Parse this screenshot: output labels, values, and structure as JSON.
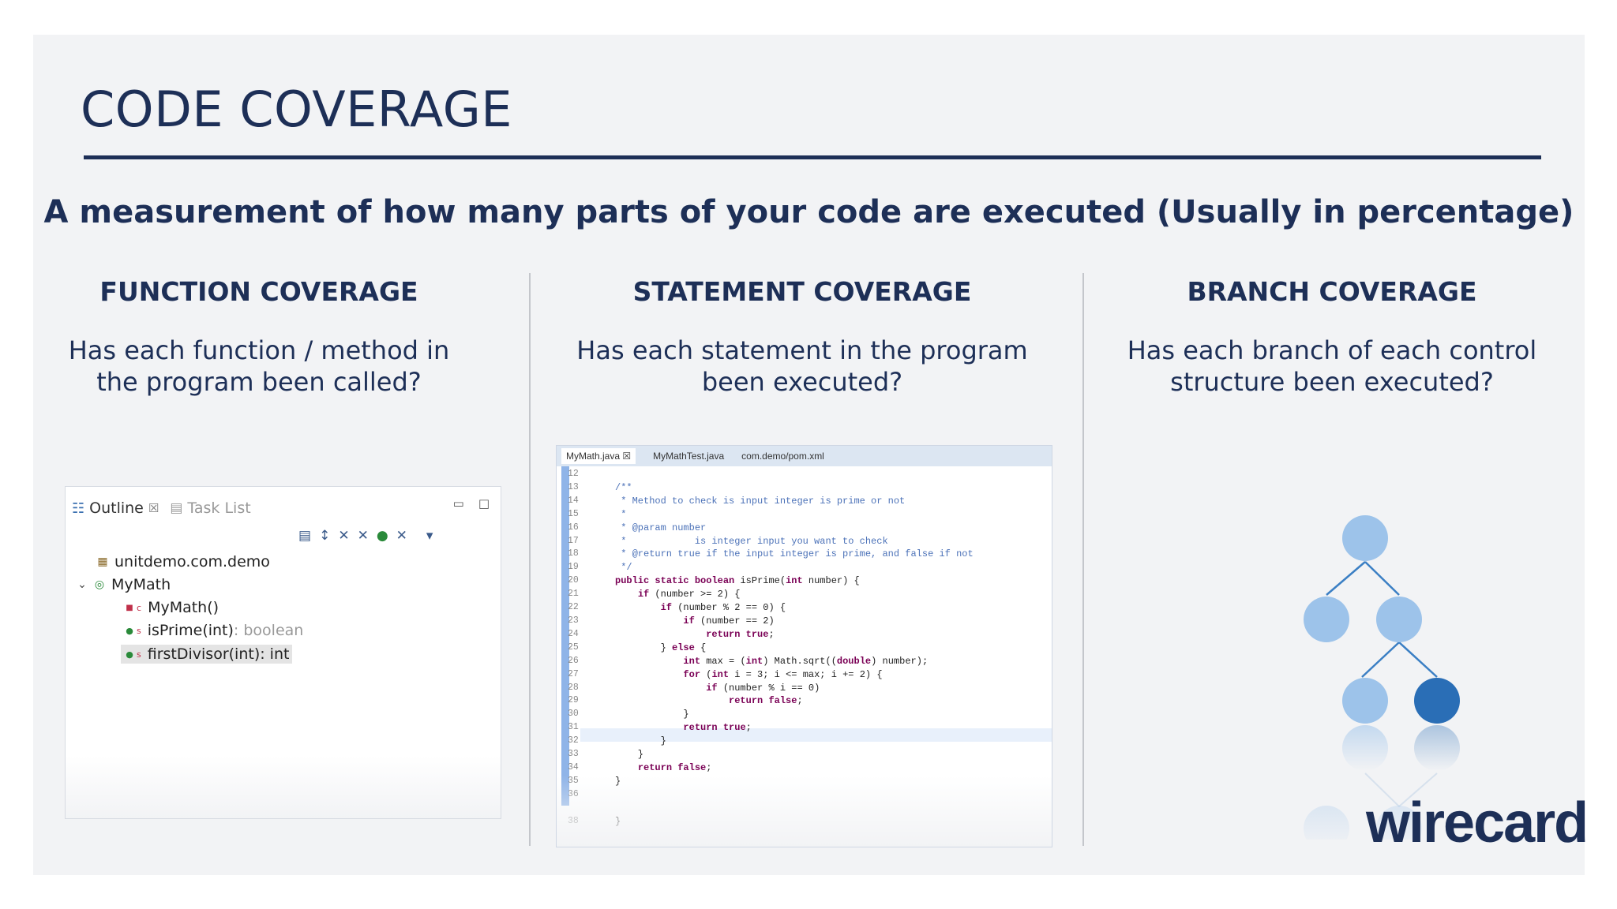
{
  "slide": {
    "title": "CODE COVERAGE",
    "subtitle": "A measurement of how many parts of your code are executed (Usually in percentage)",
    "logo": "wirecard",
    "colors": {
      "navy": "#1d2f57",
      "node_light": "#9dc3ea",
      "node_dark": "#2a6eb6",
      "background": "#f2f3f5"
    }
  },
  "columns": [
    {
      "heading": "FUNCTION COVERAGE",
      "desc_line1": "Has each function / method in",
      "desc_line2": "the program been called?"
    },
    {
      "heading": "STATEMENT COVERAGE",
      "desc_line1": "Has each statement in the program",
      "desc_line2": "been executed?"
    },
    {
      "heading": "BRANCH COVERAGE",
      "desc_line1": "Has each branch of each control",
      "desc_line2": "structure been executed?"
    }
  ],
  "outline_panel": {
    "tab_outline": "Outline",
    "tab_outline_close": "☒",
    "tab_tasklist": "Task List",
    "win_minimize": "▭",
    "win_maximize": "□",
    "toolbar_icons": [
      "▤",
      "↕",
      "✕",
      "✕",
      "●",
      "✕",
      "▾"
    ],
    "rows": [
      {
        "icon": "package-icon",
        "glyph": "▦",
        "label": "unitdemo.com.demo",
        "suffix": ""
      },
      {
        "icon": "class-icon",
        "glyph": "◎",
        "label": "MyMath",
        "suffix": ""
      },
      {
        "icon": "constructor-icon",
        "glyph": "■",
        "label": "MyMath()",
        "suffix": ""
      },
      {
        "icon": "method-icon",
        "glyph": "●",
        "label": "isPrime(int)",
        "suffix": " : boolean"
      },
      {
        "icon": "method-icon",
        "glyph": "●",
        "label": "firstDivisor(int)",
        "suffix": " : int"
      }
    ],
    "expand_glyph": "⌄",
    "constructor_mark": "c",
    "static_mark": "s"
  },
  "editor": {
    "tabs": [
      "MyMath.java ☒",
      "MyMathTest.java",
      "com.demo/pom.xml"
    ],
    "line_numbers": [
      "12",
      "13",
      "14",
      "15",
      "16",
      "17",
      "18",
      "19",
      "20",
      "21",
      "22",
      "23",
      "24",
      "25",
      "26",
      "27",
      "28",
      "29",
      "30",
      "31",
      "32",
      "33",
      "34",
      "35",
      "36",
      "",
      "38"
    ],
    "code": [
      "",
      "/**",
      " * Method to check is input integer is prime or not",
      " *",
      " * @param number",
      " *            is integer input you want to check",
      " * @return true if the input integer is prime, and false if not",
      " */",
      "public static boolean isPrime(int number) {",
      "    if (number >= 2) {",
      "        if (number % 2 == 0) {",
      "            if (number == 2)",
      "                return true;",
      "        } else {",
      "            int max = (int) Math.sqrt((double) number);",
      "            for (int i = 3; i <= max; i += 2) {",
      "                if (number % i == 0)",
      "                    return false;",
      "            }",
      "            return true;",
      "        }",
      "    }",
      "    return false;",
      "}",
      "",
      "",
      "}"
    ],
    "mirror_text": "return false;"
  }
}
